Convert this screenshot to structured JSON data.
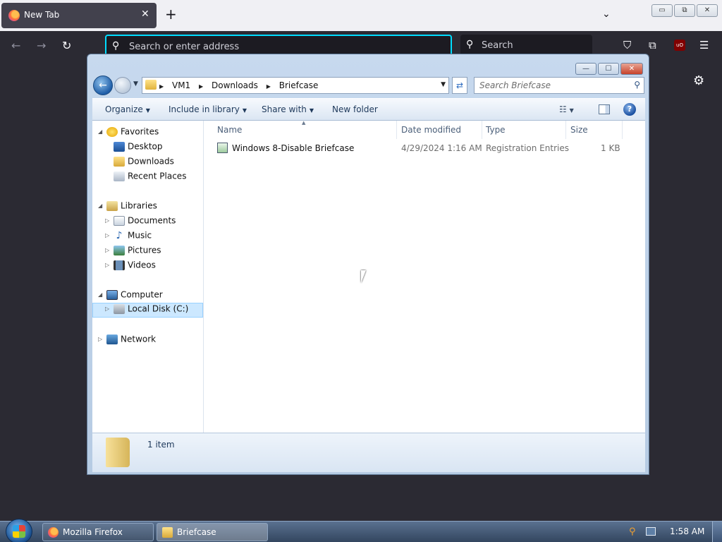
{
  "browser": {
    "tab_title": "New Tab",
    "tab_close": "✕",
    "new_tab": "+",
    "list_all_tabs": "⌄",
    "window_controls": [
      "▭",
      "⧉",
      "✕"
    ],
    "address_placeholder": "Search or enter address",
    "search_placeholder": "Search",
    "back": "←",
    "forward": "→",
    "reload": "↻",
    "pocket": "⛉",
    "extensions": "⧉",
    "ublock_label": "uO",
    "menu": "☰",
    "gear": "⚙",
    "accent_color": "#00ddff"
  },
  "explorer": {
    "caption_controls": [
      "—",
      "☐",
      "✕"
    ],
    "breadcrumbs": [
      "VM1",
      "Downloads",
      "Briefcase"
    ],
    "search_placeholder": "Search Briefcase",
    "commands": {
      "organize": "Organize",
      "include_in_library": "Include in library",
      "share_with": "Share with",
      "new_folder": "New folder"
    },
    "help": "?",
    "nav": {
      "favorites": "Favorites",
      "desktop": "Desktop",
      "downloads": "Downloads",
      "recent_places": "Recent Places",
      "libraries": "Libraries",
      "documents": "Documents",
      "music": "Music",
      "pictures": "Pictures",
      "videos": "Videos",
      "computer": "Computer",
      "local_disk": "Local Disk (C:)",
      "network": "Network"
    },
    "columns": {
      "name": "Name",
      "date_modified": "Date modified",
      "type": "Type",
      "size": "Size"
    },
    "files": [
      {
        "name": "Windows 8-Disable Briefcase",
        "date_modified": "4/29/2024 1:16 AM",
        "type": "Registration Entries",
        "size": "1 KB"
      }
    ],
    "status": "1 item"
  },
  "taskbar": {
    "apps": [
      "Mozilla Firefox",
      "Briefcase"
    ],
    "clock": "1:58 AM"
  }
}
